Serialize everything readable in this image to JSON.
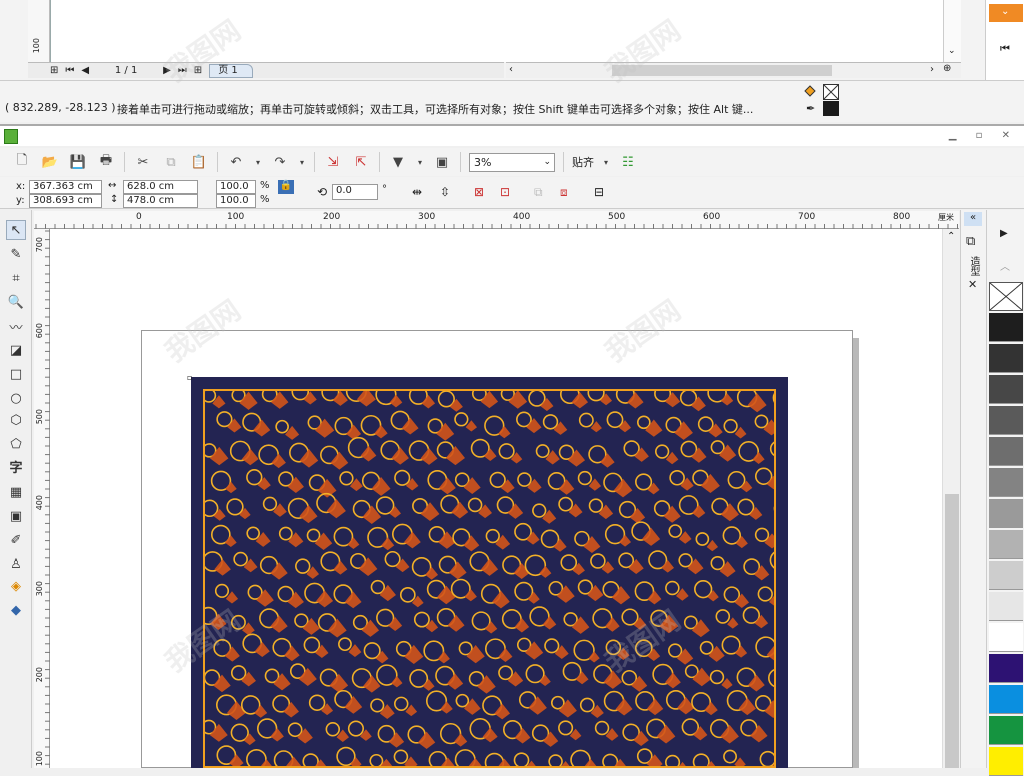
{
  "prev_window": {
    "ruler_label": "100",
    "ruler_unit": "厘米",
    "page_counter": "1 / 1",
    "page_tab": "页 1"
  },
  "status": {
    "coords": "( 832.289, -28.123 )",
    "hint": "接着单击可进行拖动或缩放；再单击可旋转或倾斜；双击工具，可选择所有对象；按住 Shift 键单击可选择多个对象；按住 Alt 键..."
  },
  "toolbar": {
    "zoom": "3%",
    "snap": "贴齐"
  },
  "props": {
    "x_label": "x:",
    "x": "367.363 cm",
    "y_label": "y:",
    "y": "308.693 cm",
    "width": "628.0 cm",
    "height": "478.0 cm",
    "scale_x": "100.0",
    "scale_y": "100.0",
    "pct": "%",
    "rotation": "0.0",
    "deg": "°"
  },
  "hruler": {
    "ticks": [
      "0",
      "100",
      "200",
      "300",
      "400",
      "500",
      "600",
      "700",
      "800"
    ],
    "unit": "厘米"
  },
  "vruler": {
    "ticks": [
      "700",
      "600",
      "500",
      "400",
      "300",
      "200",
      "100"
    ]
  },
  "docker": {
    "tab_label": "造型"
  },
  "palette": {
    "colors": [
      "#1e1e1e",
      "#333333",
      "#474747",
      "#5a5a5a",
      "#6e6e6e",
      "#838383",
      "#9a9a9a",
      "#b2b2b2",
      "#cdcdcd",
      "#e6e6e6",
      "#ffffff",
      "#2d1273",
      "#0a8fe0",
      "#159440",
      "#ffee00"
    ]
  },
  "colors": {
    "rug_bg": "#232452",
    "rug_border": "#f0a020",
    "leaf": "#d3541a",
    "swirl": "#f2b028"
  },
  "watermark": "我图网"
}
